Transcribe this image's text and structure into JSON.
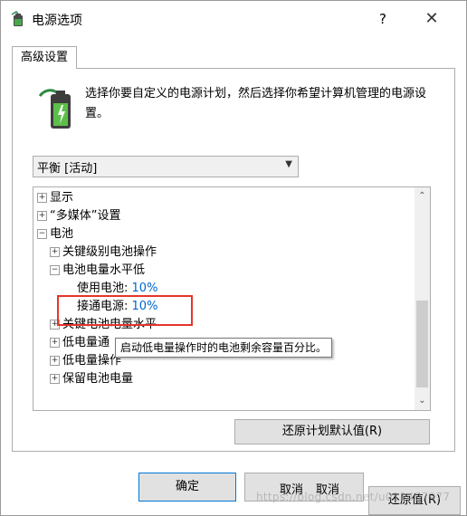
{
  "window": {
    "title": "电源选项",
    "help_glyph": "?",
    "close_glyph": "✕"
  },
  "tab": {
    "label": "高级设置"
  },
  "description": "选择你要自定义的电源计划，然后选择你希望计算机管理的电源设置。",
  "plan_select": {
    "value": "平衡 [活动]"
  },
  "tree": {
    "items": [
      {
        "expander": "+",
        "label": "显示"
      },
      {
        "expander": "+",
        "label": "“多媒体”设置"
      },
      {
        "expander": "−",
        "label": "电池"
      },
      {
        "expander": "+",
        "label": "关键级别电池操作"
      },
      {
        "expander": "−",
        "label": "电池电量水平低"
      },
      {
        "label": "使用电池:",
        "value": "10%"
      },
      {
        "label": "接通电源:",
        "value": "10%"
      },
      {
        "expander": "+",
        "label": "关键电池电量水平"
      },
      {
        "expander": "+",
        "label": "低电量通"
      },
      {
        "expander": "+",
        "label": "低电量操作"
      },
      {
        "expander": "+",
        "label": "保留电池电量"
      }
    ]
  },
  "tooltip": "启动低电量操作时的电池剩余容量百分比。",
  "buttons": {
    "restore_defaults": "还原计划默认值(R)",
    "ok": "确定",
    "cancel_1": "取消",
    "cancel_2": "取消",
    "apply": "还原值(R)"
  },
  "watermark": "https://blog.csdn.net/u011407977",
  "colors": {
    "accent_link": "#0066cc",
    "highlight_border": "#e5352b"
  }
}
